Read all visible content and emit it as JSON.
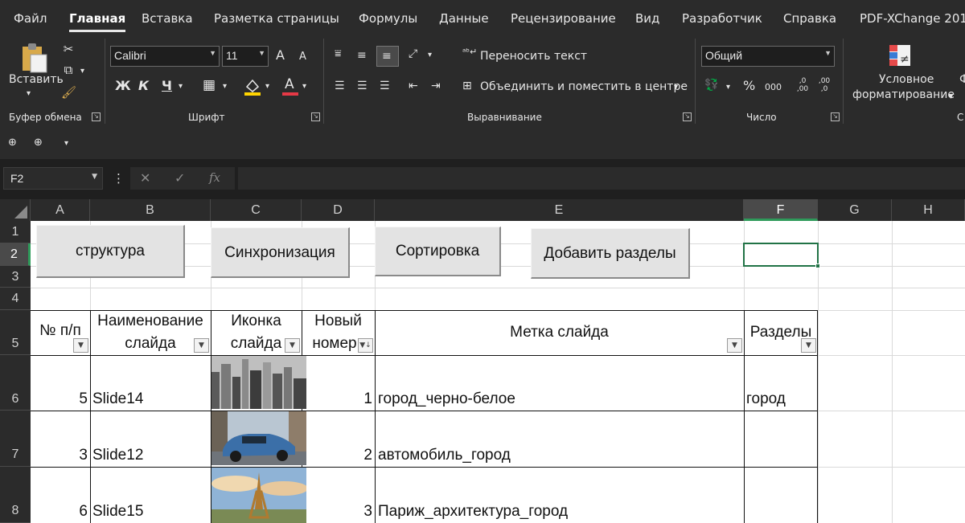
{
  "menu_tabs": [
    "Файл",
    "Главная",
    "Вставка",
    "Разметка страницы",
    "Формулы",
    "Данные",
    "Рецензирование",
    "Вид",
    "Разработчик",
    "Справка",
    "PDF-XChange 201"
  ],
  "active_tab": "Главная",
  "ribbon": {
    "paste_label": "Вставить",
    "clipboard_label": "Буфер обмена",
    "font_name": "Calibri",
    "font_size": "11",
    "font_grow": "A",
    "font_shrink": "A",
    "bold": "Ж",
    "italic": "К",
    "underline": "Ч",
    "font_color_letter": "A",
    "font_label": "Шрифт",
    "wrap_text": "Переносить текст",
    "merge_center": "Объединить и поместить в центре",
    "alignment_label": "Выравнивание",
    "number_format": "Общий",
    "percent": "%",
    "thousands": "000",
    "dec_inc": ",0 ,00",
    "dec_dec": ",00 ,0",
    "number_label": "Число",
    "cond_format_line1": "Условное",
    "cond_format_line2": "форматирование",
    "cut_label": "С"
  },
  "formula_bar": {
    "name_box": "F2",
    "fx": "fx",
    "formula": ""
  },
  "columns": [
    "A",
    "B",
    "C",
    "D",
    "E",
    "F",
    "G",
    "H"
  ],
  "rows": [
    "1",
    "2",
    "3",
    "4",
    "5",
    "6",
    "7",
    "8"
  ],
  "sheet_buttons": [
    "структура",
    "Синхронизация",
    "Сортировка",
    "Добавить  разделы"
  ],
  "table": {
    "headers": [
      {
        "line1": "№ п/п",
        "line2": ""
      },
      {
        "line1": "Наименование",
        "line2": "слайда"
      },
      {
        "line1": "Иконка",
        "line2": "слайда"
      },
      {
        "line1": "Новый",
        "line2": "номер"
      },
      {
        "line1": "Метка слайда",
        "line2": ""
      },
      {
        "line1": "Разделы",
        "line2": ""
      }
    ],
    "rows": [
      {
        "num": "5",
        "name": "Slide14",
        "image": "city-bw",
        "new_num": "1",
        "tag": "город_черно-белое",
        "section": "город"
      },
      {
        "num": "3",
        "name": "Slide12",
        "image": "car-city",
        "new_num": "2",
        "tag": "автомобиль_город",
        "section": ""
      },
      {
        "num": "6",
        "name": "Slide15",
        "image": "paris",
        "new_num": "3",
        "tag": "Париж_архитектура_город",
        "section": ""
      }
    ]
  },
  "colors": {
    "ribbon_bg": "#2b2b2b",
    "selected_cell_border": "#217346",
    "font_color_bar": "#e63946",
    "highlight_bar": "#ffd400"
  }
}
